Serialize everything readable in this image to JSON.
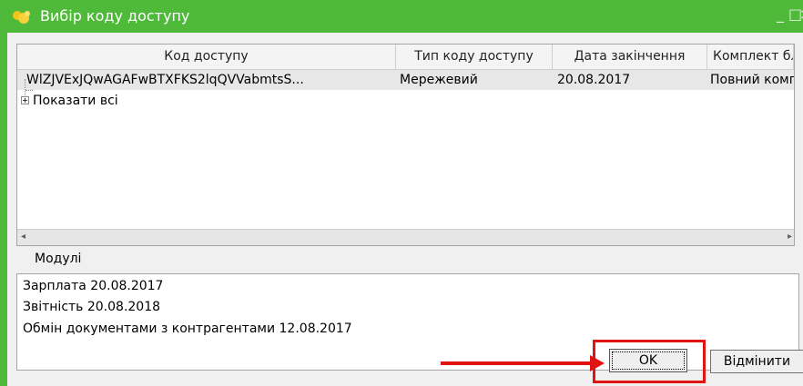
{
  "window": {
    "title": "Вибір коду доступу",
    "minimize_glyph": "_",
    "maximize_glyph": "□",
    "close_glyph": "×",
    "accent_color": "#4fba3a",
    "highlight_color": "#e11414"
  },
  "grid": {
    "columns": [
      "Код доступу",
      "Тип коду доступу",
      "Дата закінчення",
      "Комплект бл"
    ],
    "rows": [
      {
        "code": "WlZJVExJQwAGAFwBTXFKS2lqQVVabmtsS...",
        "type": "Мережевий",
        "expires": "20.08.2017",
        "bundle": "Повний комп"
      }
    ],
    "show_all_label": "Показати всі",
    "scroll_left_glyph": "◂",
    "scroll_right_glyph": "▸"
  },
  "modules": {
    "label": "Модулі",
    "items": [
      "Зарплата 20.08.2017",
      "Звітність 20.08.2018",
      "Обмін документами з контрагентами 12.08.2017"
    ]
  },
  "buttons": {
    "ok": "OK",
    "cancel": "Відмінити"
  }
}
